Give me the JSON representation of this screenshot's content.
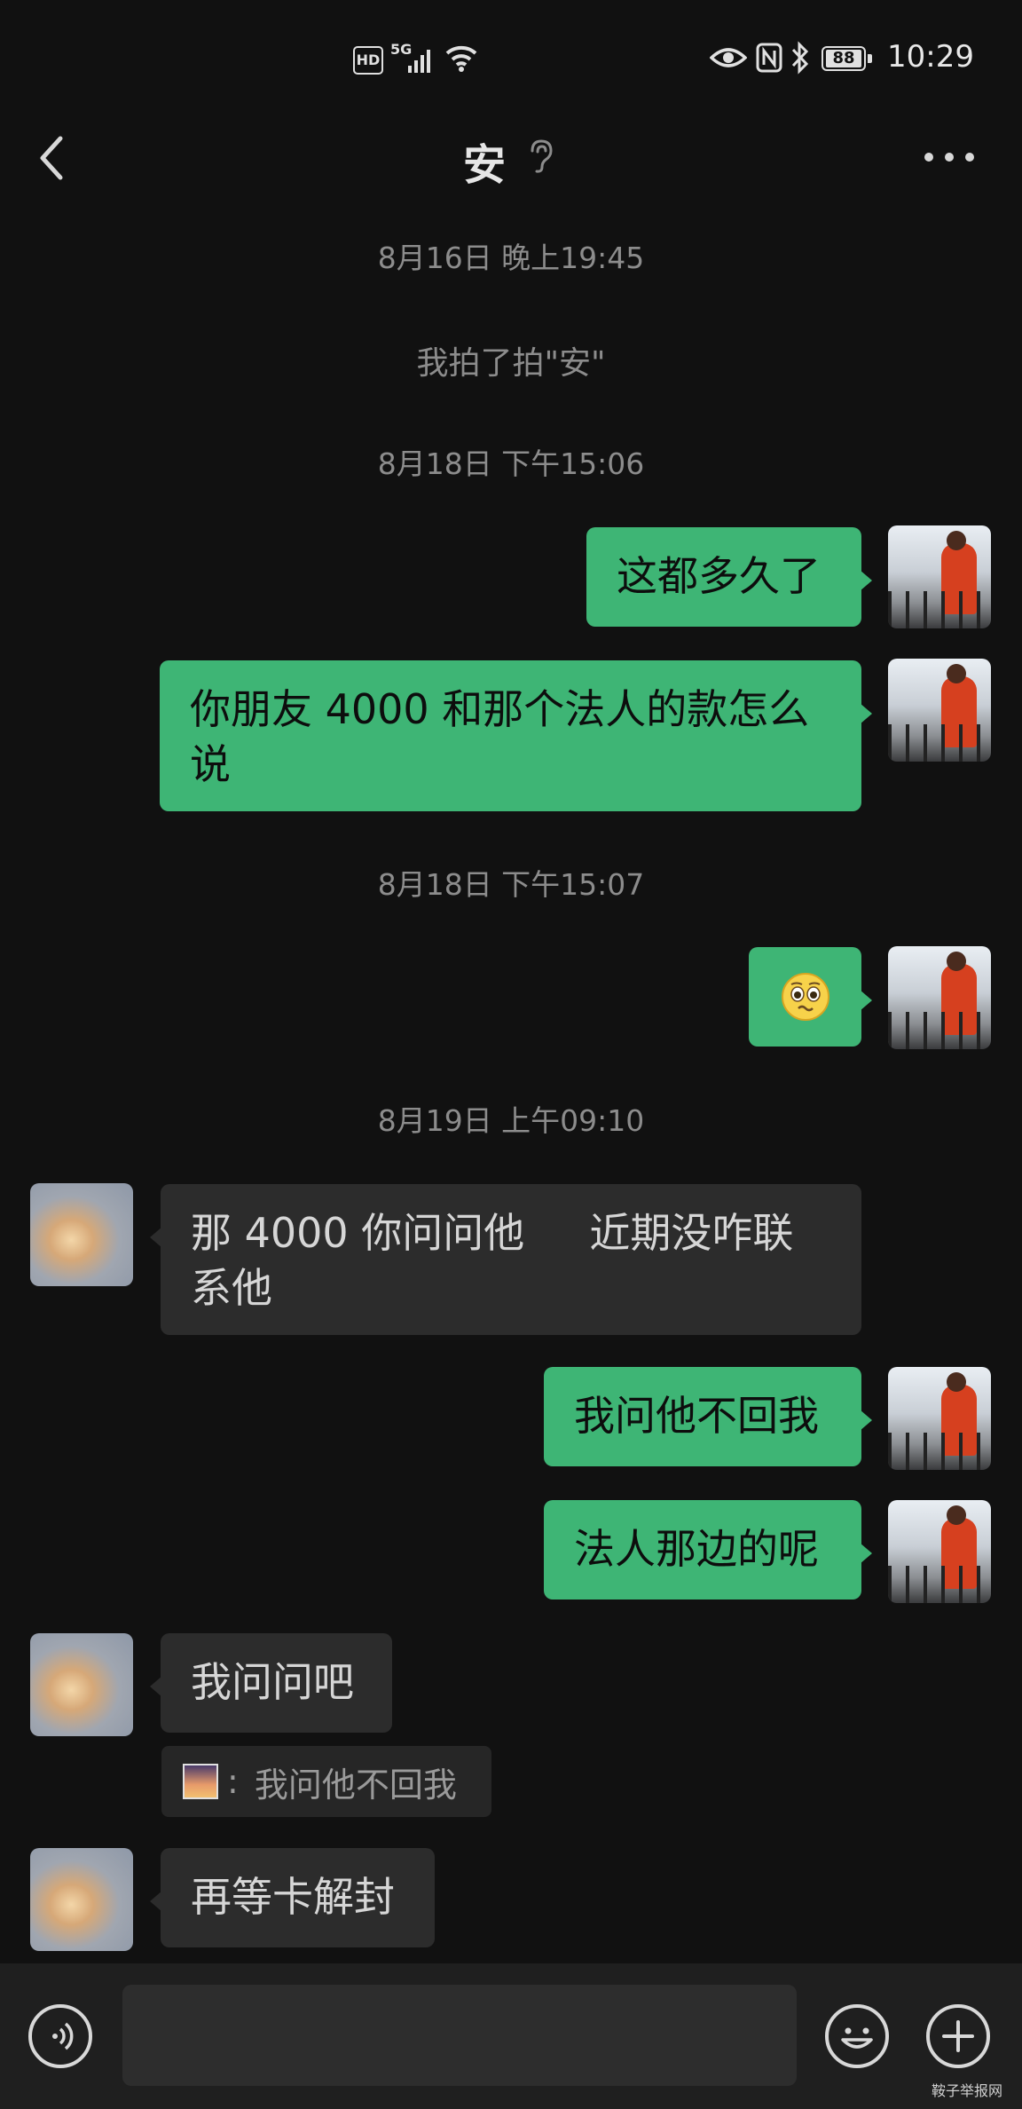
{
  "status_bar": {
    "time": "10:29",
    "network": "5G",
    "hd": "HD",
    "battery": "88"
  },
  "header": {
    "title": "安"
  },
  "messages": [
    {
      "kind": "timestamp",
      "text": "8月16日 晚上19:45"
    },
    {
      "kind": "system",
      "text": "我拍了拍\"安\""
    },
    {
      "kind": "timestamp",
      "text": "8月18日 下午15:06"
    },
    {
      "kind": "outgoing",
      "text": "这都多久了"
    },
    {
      "kind": "outgoing",
      "text": "你朋友 4000 和那个法人的款怎么说"
    },
    {
      "kind": "timestamp",
      "text": "8月18日 下午15:07"
    },
    {
      "kind": "outgoing",
      "text": "pleading-face-emoji"
    },
    {
      "kind": "timestamp",
      "text": "8月19日 上午09:10"
    },
    {
      "kind": "incoming",
      "text": "那 4000 你问问他     近期没咋联系他"
    },
    {
      "kind": "outgoing",
      "text": "我问他不回我"
    },
    {
      "kind": "outgoing",
      "text": "法人那边的呢"
    },
    {
      "kind": "incoming",
      "text": "我问问吧"
    },
    {
      "kind": "quote",
      "sep": ":",
      "text": "我问他不回我"
    },
    {
      "kind": "incoming",
      "text": "再等卡解封"
    }
  ],
  "watermark": "鞍子举报网",
  "colors": {
    "background": "#111111",
    "outgoing_bubble": "#3eb575",
    "incoming_bubble": "#2c2c2c",
    "timestamp_text": "#8c8c8c"
  },
  "icons": [
    "back-arrow-icon",
    "ear-icon",
    "more-icon",
    "voice-icon",
    "emoji-icon",
    "plus-icon"
  ]
}
